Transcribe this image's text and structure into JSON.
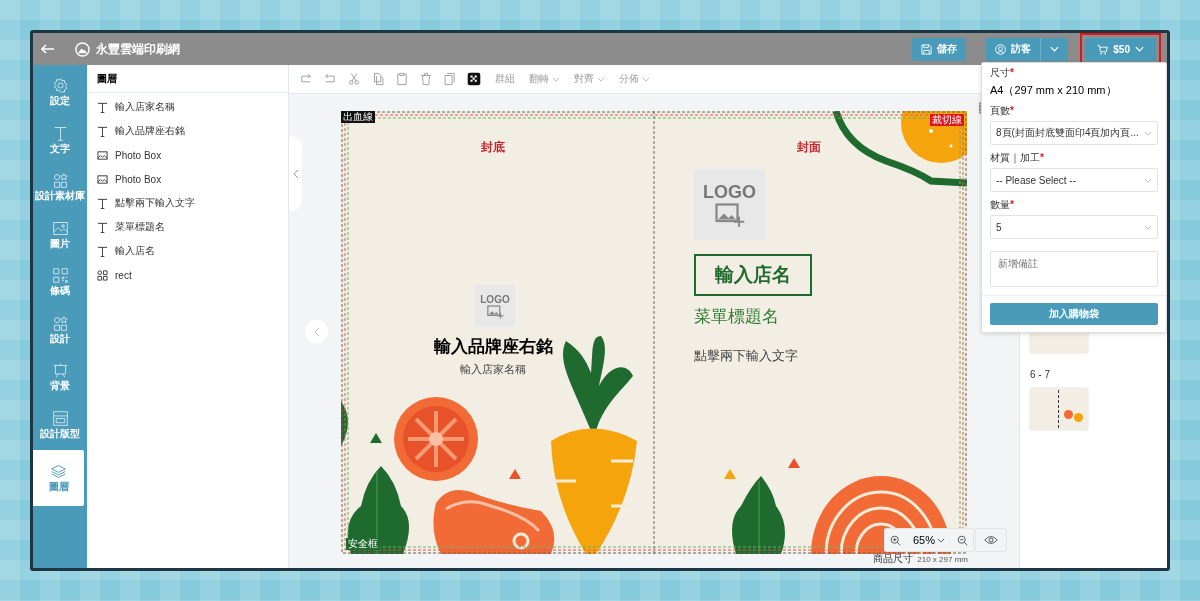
{
  "top_bar": {
    "app_name": "永豐雲端印刷網",
    "save_button": "儲存",
    "account_button": "訪客",
    "cart_button": {
      "label": "$50",
      "highlighted": true
    }
  },
  "sidebar": {
    "items": [
      {
        "label": "設定",
        "selected": false
      },
      {
        "label": "文字",
        "selected": false
      },
      {
        "label": "設計素材庫",
        "selected": false
      },
      {
        "label": "圖片",
        "selected": false
      },
      {
        "label": "條碼",
        "selected": false
      },
      {
        "label": "設計",
        "selected": false
      },
      {
        "label": "背景",
        "selected": false
      },
      {
        "label": "設計版型",
        "selected": false
      },
      {
        "label": "圖層",
        "selected": true
      }
    ]
  },
  "layers_panel": {
    "title": "圖層",
    "items": [
      {
        "kind": "text",
        "label": "輸入店家名稱"
      },
      {
        "kind": "text",
        "label": "輸入品牌座右銘"
      },
      {
        "kind": "image",
        "label": "Photo Box"
      },
      {
        "kind": "image",
        "label": "Photo Box"
      },
      {
        "kind": "text",
        "label": "點擊兩下輸入文字"
      },
      {
        "kind": "text",
        "label": "菜單標題名"
      },
      {
        "kind": "text",
        "label": "輸入店名"
      },
      {
        "kind": "group",
        "label": "rect"
      }
    ]
  },
  "toolbar": {
    "group_label": "群組",
    "menus": [
      {
        "label": "翻轉"
      },
      {
        "label": "對齊"
      },
      {
        "label": "分佈"
      }
    ]
  },
  "canvas": {
    "bleed_label": "出血線",
    "trim_label": "裁切線",
    "safe_label": "安全框",
    "back_cover": {
      "heading": "封底",
      "logo": "LOGO",
      "slogan": "輸入品牌座右銘",
      "shop_name": "輸入店家名稱"
    },
    "front_cover": {
      "heading": "封面",
      "logo": "LOGO",
      "shop_name": "輸入店名",
      "menu_title": "菜單標題名",
      "hint": "點擊兩下輸入文字"
    },
    "zoom": "65%",
    "product_size": {
      "label": "商品尺寸",
      "value": "210 x 297 mm"
    }
  },
  "pages_panel": {
    "pages": [
      {
        "label": "6 - 7"
      }
    ]
  },
  "cart_dropdown": {
    "size": {
      "label": "尺寸",
      "required_mark": "*",
      "value": "A4（297 mm x 210 mm）"
    },
    "pages": {
      "label": "頁數",
      "required_mark": "*",
      "value": "8頁(封面封底雙面印4頁加內頁..."
    },
    "material": {
      "label": "材質｜加工",
      "required_mark": "*",
      "value": "-- Please Select --"
    },
    "quantity": {
      "label": "數量",
      "required_mark": "*",
      "value": "5"
    },
    "note": {
      "placeholder": "新增備註"
    },
    "submit": "加入購物袋"
  }
}
